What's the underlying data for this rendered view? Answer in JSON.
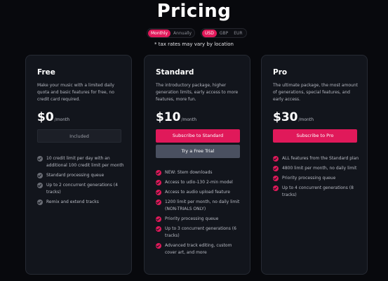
{
  "header": {
    "title": "Pricing",
    "tax_note": "* tax rates may vary by location"
  },
  "billing_toggle": {
    "monthly": "Monthly",
    "annually": "Annually",
    "selected": "Monthly"
  },
  "currency_toggle": {
    "usd": "USD",
    "gbp": "GBP",
    "eur": "EUR",
    "selected": "USD"
  },
  "colors": {
    "accent": "#e0195a",
    "background": "#08090d",
    "card": "#12151c",
    "secondary_button": "#4a5060"
  },
  "plans": {
    "free": {
      "name": "Free",
      "description": "Make your music with a limited daily quota and basic features for free, no credit card required.",
      "price": "$0",
      "per": "/month",
      "button": "Included",
      "features": [
        "10 credit limit per day with an additional 100 credit limit per month",
        "Standard processing queue",
        "Up to 2 concurrent generations (4 tracks)",
        "Remix and extend tracks"
      ]
    },
    "standard": {
      "name": "Standard",
      "description": "The introductory package, higher generation limits, early access to more features, more fun.",
      "price": "$10",
      "per": "/month",
      "button": "Subscribe to Standard",
      "trial_button": "Try a Free Trial",
      "features": [
        "NEW: Stem downloads",
        "Access to udio-130 2-min model",
        "Access to audio upload feature",
        "1200 limit per month, no daily limit (NON-TRIALS ONLY)",
        "Priority processing queue",
        "Up to 3 concurrent generations (6 tracks)",
        "Advanced track editing, custom cover art, and more"
      ]
    },
    "pro": {
      "name": "Pro",
      "description": "The ultimate package, the most amount of generations, special features, and early access.",
      "price": "$30",
      "per": "/month",
      "button": "Subscribe to Pro",
      "features": [
        "ALL features from the Standard plan",
        "4800 limit per month, no daily limit",
        "Priority processing queue",
        "Up to 4 concurrent generations (8 tracks)"
      ]
    }
  }
}
